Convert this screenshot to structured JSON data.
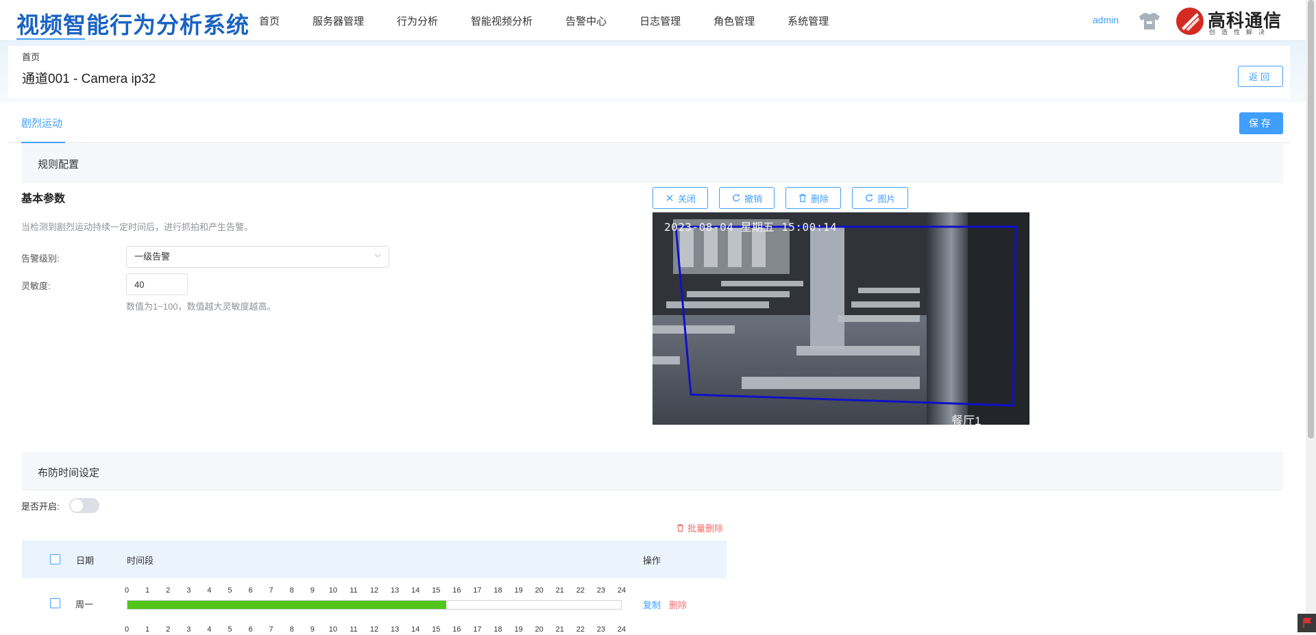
{
  "app": {
    "title": "视频智能行为分析系统",
    "user": "admin",
    "brand_name": "高科通信",
    "brand_slogan": "创造性解决",
    "accent_color": "#409eff"
  },
  "nav": {
    "items": [
      "首页",
      "服务器管理",
      "行为分析",
      "智能视频分析",
      "告警中心",
      "日志管理",
      "角色管理",
      "系统管理"
    ]
  },
  "header": {
    "breadcrumb": "首页",
    "title": "通道001 - Camera ip32",
    "back_label": "返回"
  },
  "tabs": {
    "active": "剧烈运动",
    "save_label": "保存"
  },
  "rule_config": {
    "section_title": "规则配置",
    "basic_title": "基本参数",
    "description": "当检测到剧烈运动持续一定时间后，进行抓拍和产生告警。",
    "alarm_level_label": "告警级别:",
    "alarm_level_value": "一级告警",
    "sensitivity_label": "灵敏度:",
    "sensitivity_value": "40",
    "sensitivity_hint": "数值为1~100，数值越大灵敏度越高。"
  },
  "toolbar": {
    "close_label": "关闭",
    "undo_label": "撤销",
    "delete_label": "删除",
    "image_label": "图片"
  },
  "camera": {
    "timestamp": "2023-08-04  星期五  15:00:14",
    "location": "餐厅1",
    "region_color": "#1010c8"
  },
  "schedule": {
    "section_title": "布防时间设定",
    "enable_label": "是否开启:",
    "enabled": false,
    "batch_delete_label": "批量删除",
    "columns": {
      "date": "日期",
      "period": "时间段",
      "action": "操作"
    },
    "hours": [
      "0",
      "1",
      "2",
      "3",
      "4",
      "5",
      "6",
      "7",
      "8",
      "9",
      "10",
      "11",
      "12",
      "13",
      "14",
      "15",
      "16",
      "17",
      "18",
      "19",
      "20",
      "21",
      "22",
      "23",
      "24"
    ],
    "rows": [
      {
        "day": "周一",
        "fill_fraction": 0.646,
        "copy_label": "复制",
        "delete_label": "删除"
      }
    ]
  }
}
